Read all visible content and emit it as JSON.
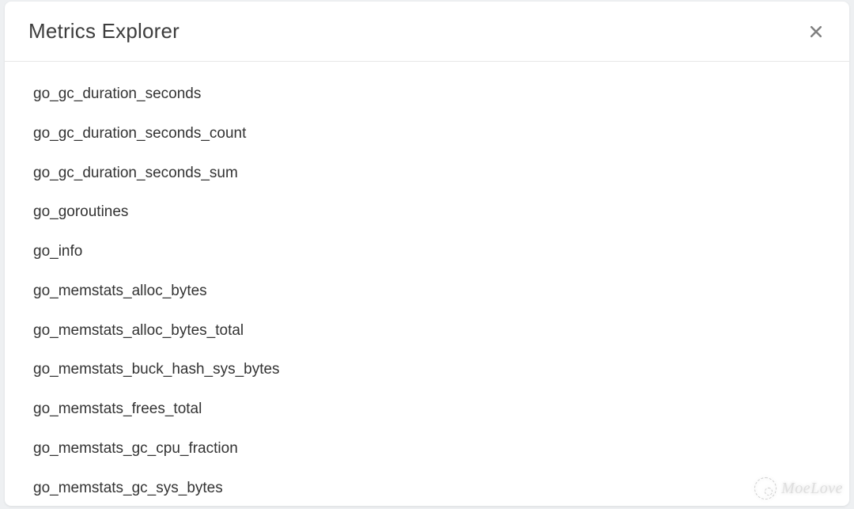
{
  "modal": {
    "title": "Metrics Explorer"
  },
  "metrics": [
    "go_gc_duration_seconds",
    "go_gc_duration_seconds_count",
    "go_gc_duration_seconds_sum",
    "go_goroutines",
    "go_info",
    "go_memstats_alloc_bytes",
    "go_memstats_alloc_bytes_total",
    "go_memstats_buck_hash_sys_bytes",
    "go_memstats_frees_total",
    "go_memstats_gc_cpu_fraction",
    "go_memstats_gc_sys_bytes"
  ],
  "watermark": {
    "text": "MoeLove"
  }
}
